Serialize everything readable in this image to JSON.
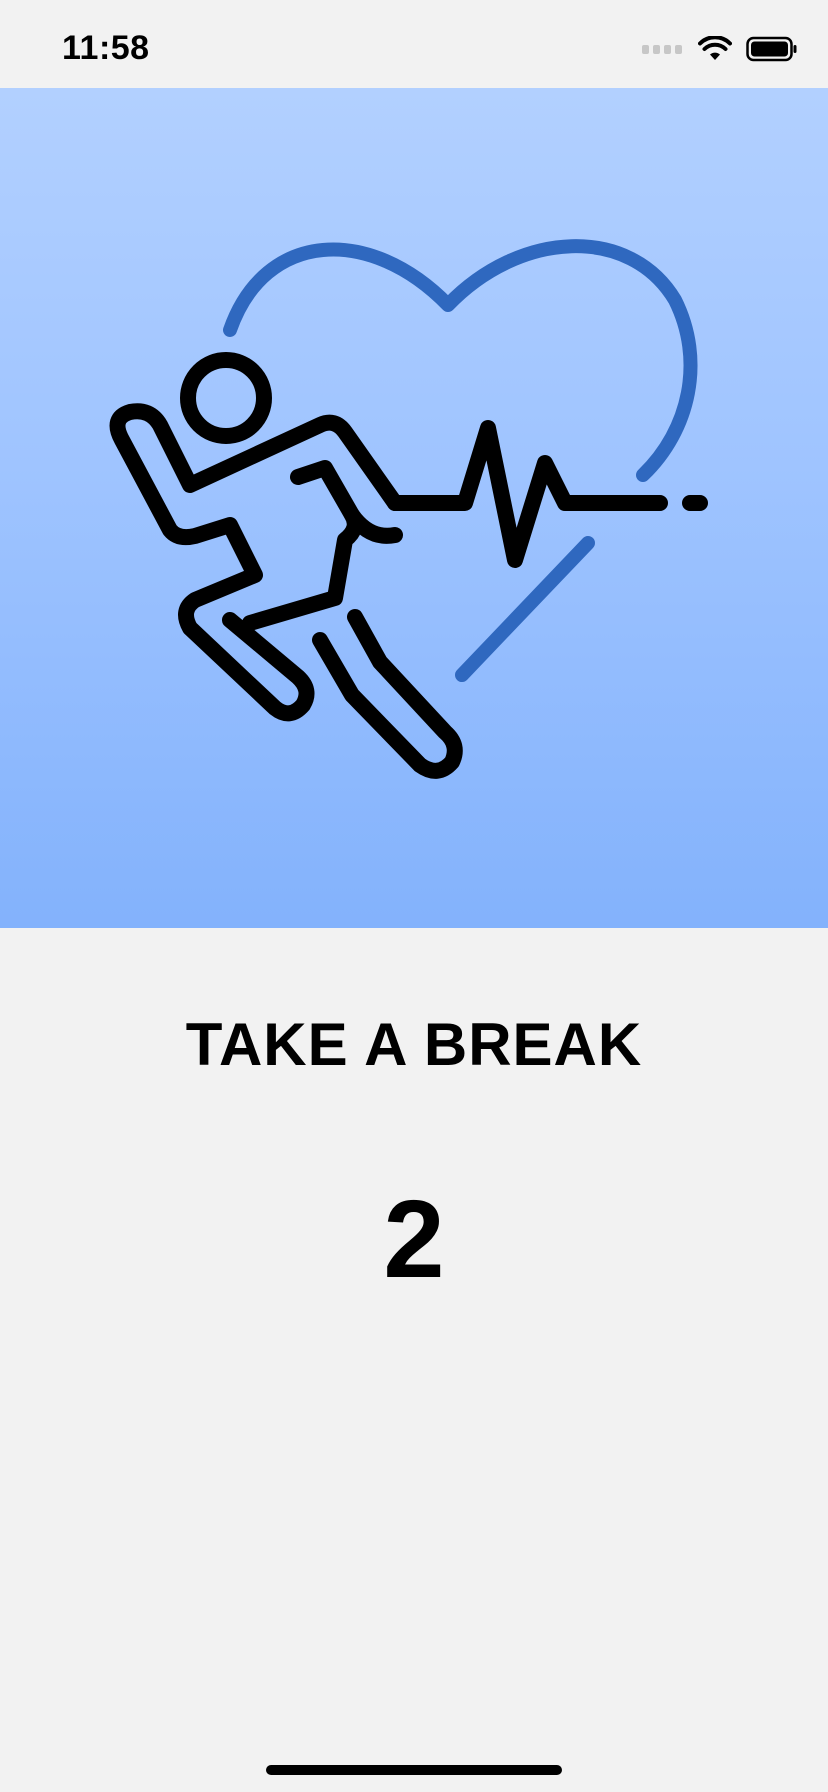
{
  "status_bar": {
    "time": "11:58"
  },
  "hero": {
    "icon": "running-person-heart-icon",
    "accent_color": "#2f68bf",
    "gradient_top": "#b2d0ff",
    "gradient_bottom": "#83b2fc"
  },
  "main": {
    "title": "TAKE A BREAK",
    "counter": "2"
  }
}
